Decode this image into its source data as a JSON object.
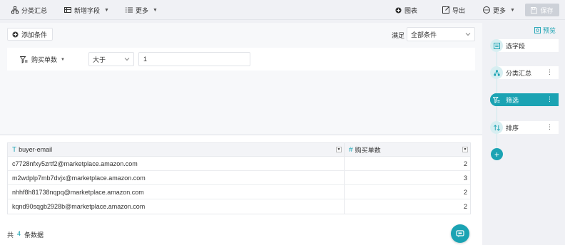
{
  "toolbar": {
    "group_summary": "分类汇总",
    "new_field": "新增字段",
    "more_left": "更多",
    "chart": "图表",
    "export": "导出",
    "more_right": "更多",
    "save": "保存"
  },
  "filter": {
    "add_condition": "添加条件",
    "satisfy_label": "满足",
    "satisfy_value": "全部条件",
    "condition": {
      "field": "购买单数",
      "operator": "大于",
      "value": "1"
    }
  },
  "table": {
    "columns": [
      {
        "label": "buyer-email",
        "type_icon": "text-type-icon"
      },
      {
        "label": "购买单数",
        "type_icon": "number-type-icon"
      }
    ],
    "rows": [
      {
        "email": "c7728nfxy5zrtf2@marketplace.amazon.com",
        "count": "2"
      },
      {
        "email": "m2wdplp7mb7dvjx@marketplace.amazon.com",
        "count": "3"
      },
      {
        "email": "nhhf8h81738nqpq@marketplace.amazon.com",
        "count": "2"
      },
      {
        "email": "kqnd90sqgb2928b@marketplace.amazon.com",
        "count": "2"
      }
    ]
  },
  "footer": {
    "prefix": "共",
    "count": "4",
    "suffix": "条数据"
  },
  "steps": {
    "preview": "预览",
    "items": [
      {
        "label": "选字段",
        "icon": "select-field-icon"
      },
      {
        "label": "分类汇总",
        "icon": "group-summary-icon"
      },
      {
        "label": "筛选",
        "icon": "filter-icon"
      },
      {
        "label": "排序",
        "icon": "sort-icon"
      }
    ],
    "active_index": 2
  },
  "colors": {
    "accent": "#1ba3b3",
    "toolbar_bg": "#f0f1f5",
    "save_disabled": "#cdd1d8"
  }
}
